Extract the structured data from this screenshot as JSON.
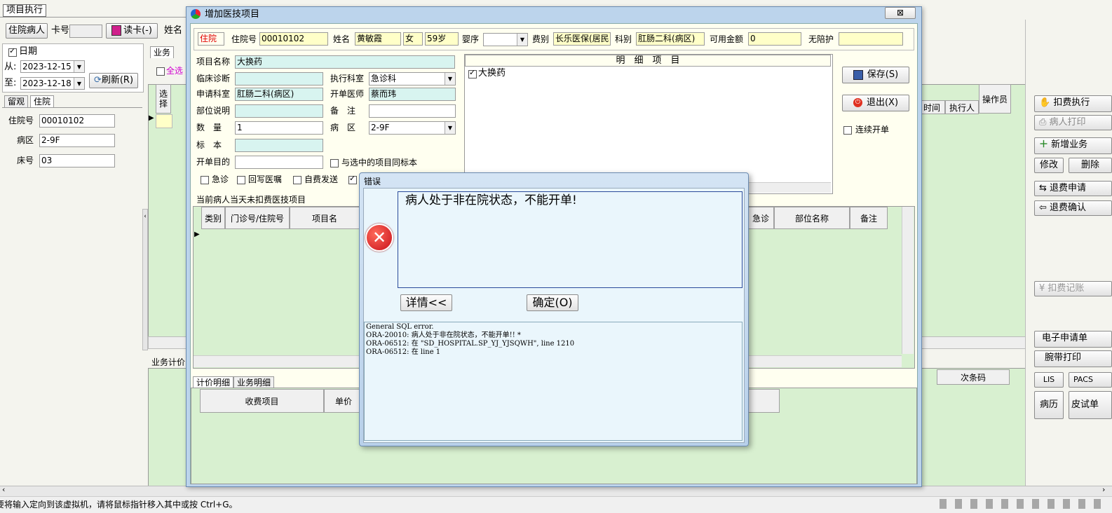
{
  "main": {
    "tab_label": "项目执行",
    "inpatient_btn": "住院病人",
    "card_label": "卡号",
    "read_card_btn": "读卡(-)",
    "name_label": "姓名",
    "date_label": "日期",
    "from_label": "从:",
    "to_label": "至:",
    "date_from": "2023-12-15",
    "date_to": "2023-12-18",
    "refresh_btn": "刷新(R)",
    "tabs_left": [
      "留观",
      "住院"
    ],
    "admission_label": "住院号",
    "admission_value": "00010102",
    "ward_label": "病区",
    "ward_value": "2-9F",
    "bed_label": "床号",
    "bed_value": "03",
    "biz_tab": "业务",
    "select_all": "全选",
    "select_col": "选择",
    "biz_pricing": "业务计价",
    "grid_headers": [
      "时间",
      "执行人",
      "操作员"
    ],
    "bottom_col": "次条码",
    "status_bar": "要将输入定向到该虚拟机，请将鼠标指针移入其中或按 Ctrl+G。"
  },
  "right_buttons": {
    "charge_exec": "扣费执行",
    "patient_print": "病人打印",
    "new_biz": "新增业务",
    "modify": "修改",
    "delete": "删除",
    "refund_req": "退费申请",
    "refund_confirm": "退费确认",
    "charge_record": "扣费记账",
    "e_request": "电子申请单",
    "wristband": "腕带打印",
    "lis": "LIS",
    "pacs": "PACS",
    "medical_record": "病历",
    "skin_test": "皮试单"
  },
  "dialog": {
    "title": "增加医技项目",
    "close": "⊠",
    "status_tag": "住院",
    "admission_label": "住院号",
    "admission_value": "00010102",
    "name_label": "姓名",
    "name_value": "黄敏霞",
    "gender_value": "女",
    "age_value": "59岁",
    "infant_label": "婴序",
    "fee_label": "费别",
    "fee_value": "长乐医保(居民",
    "dept_label": "科别",
    "dept_value": "肛肠二科(病区)",
    "avail_label": "可用金额",
    "avail_value": "0",
    "nurse_label": "无陪护",
    "item_label": "项目名称",
    "item_value": "大换药",
    "diag_label": "临床诊断",
    "exec_dept_label": "执行科室",
    "exec_dept_value": "急诊科",
    "req_dept_label": "申请科室",
    "req_dept_value": "肛肠二科(病区)",
    "doctor_label": "开单医师",
    "doctor_value": "蔡而玮",
    "part_label": "部位说明",
    "remark_label": "备　注",
    "qty_label": "数　量",
    "qty_value": "1",
    "ward_label": "病　区",
    "ward_value": "2-9F",
    "specimen_label": "标　本",
    "purpose_label": "开单目的",
    "same_specimen": "与选中的项目同标本",
    "urgent": "急诊",
    "writeback": "回写医嘱",
    "selfpay": "自费发送",
    "detail_header": "明　细　项　目",
    "detail_item": "大换药",
    "save_btn": "保存(S)",
    "exit_btn": "退出(X)",
    "continuous": "连续开单",
    "unbilled_title": "当前病人当天未扣费医技项目",
    "grid_cols": [
      "类别",
      "门诊号/住院号",
      "项目名"
    ],
    "grid_cols_right": [
      "急诊",
      "部位名称",
      "备注"
    ],
    "tabs_bottom": [
      "计价明细",
      "业务明细"
    ],
    "fee_cols": [
      "收费项目",
      "单价"
    ]
  },
  "error": {
    "title": "错误",
    "message": "病人处于非在院状态，不能开单!",
    "detail_btn": "详情<<",
    "ok_btn": "确定(O)",
    "detail_lines": [
      "General SQL error.",
      "ORA-20010: 病人处于非在院状态，不能开单!! *",
      "ORA-06512: 在 \"SD_HOSPITAL.SP_YJ_YJSQWH\", line 1210",
      "ORA-06512: 在 line 1"
    ]
  }
}
